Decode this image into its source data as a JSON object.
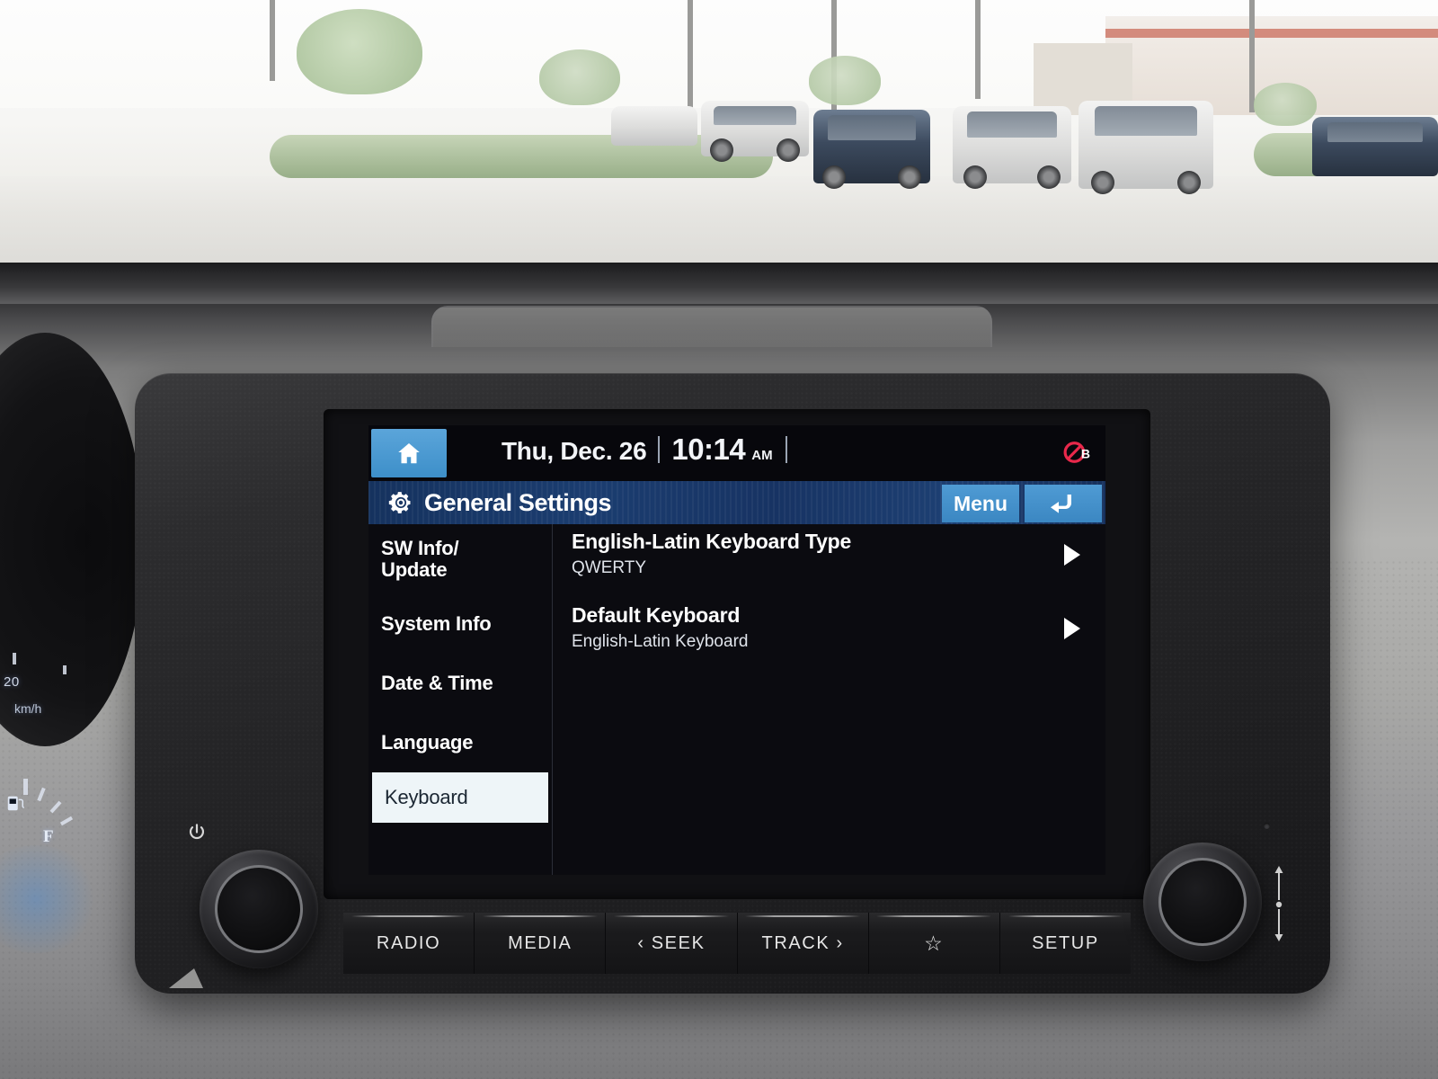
{
  "scene": {
    "label": "car-infotainment-head-unit"
  },
  "status_bar": {
    "home_icon": "home-icon",
    "date": "Thu, Dec. 26",
    "time": "10:14",
    "ampm": "AM",
    "bluetooth_status_icon": "bluetooth-disabled-icon",
    "bluetooth_label": "B"
  },
  "title_bar": {
    "gear_icon": "gear-icon",
    "title": "General Settings",
    "menu_label": "Menu",
    "back_icon": "back-arrow-icon"
  },
  "sidebar": {
    "items": [
      {
        "label": "SW Info/\nUpdate",
        "line1": "SW Info/",
        "line2": "Update",
        "selected": false
      },
      {
        "label": "System Info",
        "selected": false
      },
      {
        "label": "Date & Time",
        "selected": false
      },
      {
        "label": "Language",
        "selected": false
      },
      {
        "label": "Keyboard",
        "selected": true
      }
    ]
  },
  "content": {
    "rows": [
      {
        "title": "English-Latin Keyboard Type",
        "value": "QWERTY",
        "arrow_icon": "chevron-right-icon"
      },
      {
        "title": "Default Keyboard",
        "value": "English-Latin Keyboard",
        "arrow_icon": "chevron-right-icon"
      }
    ]
  },
  "hardware_buttons": [
    {
      "label": "RADIO",
      "icon": ""
    },
    {
      "label": "MEDIA",
      "icon": ""
    },
    {
      "label": "‹ SEEK",
      "icon": "seek-back-icon"
    },
    {
      "label": "TRACK ›",
      "icon": "track-forward-icon"
    },
    {
      "label": "☆",
      "icon": "star-favorite-icon"
    },
    {
      "label": "SETUP",
      "icon": ""
    }
  ],
  "knobs": {
    "left": {
      "name": "power-volume-knob",
      "icon": "power-icon"
    },
    "right": {
      "name": "tune-seek-knob",
      "icon": "up-down-arrow-icon"
    }
  },
  "instrument_cluster": {
    "speed_tick": "20",
    "speed_unit": "km/h",
    "fuel_full_label": "F",
    "fuel_icon": "fuel-pump-icon"
  },
  "colors": {
    "accent_blue": "#3d8fc9",
    "title_blue": "#1b3d70",
    "screen_black": "#07070c",
    "selected_bg": "#eef5f8",
    "bt_red": "#e8284b"
  }
}
